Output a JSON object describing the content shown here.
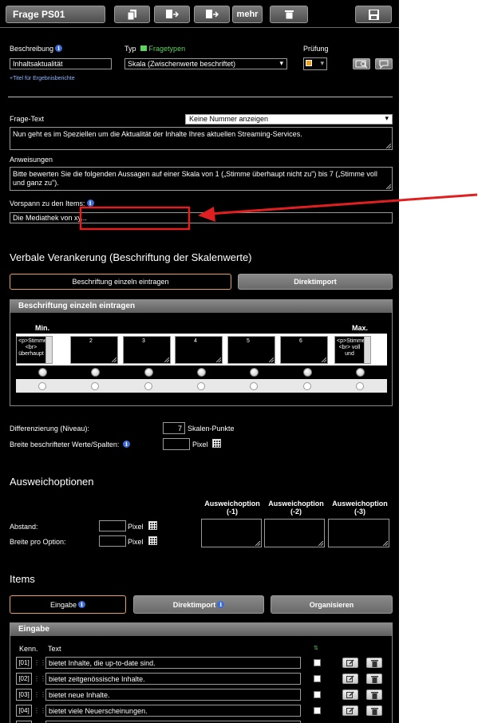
{
  "header": {
    "question_id": "Frage PS01",
    "more_label": "mehr"
  },
  "basics": {
    "description_label": "Beschreibung",
    "description_value": "Inhaltsaktualität",
    "report_title_link": "+Titel für Ergebnisberichte",
    "type_label": "Typ",
    "type_link": "Fragetypen",
    "type_value": "Skala (Zwischenwerte beschriftet)",
    "check_label": "Prüfung"
  },
  "question": {
    "text_label": "Frage-Text",
    "numbering_value": "Keine Nummer anzeigen",
    "text_value": "Nun geht es im Speziellen um die Aktualität der Inhalte Ihres aktuellen Streaming-Services.",
    "instructions_label": "Anweisungen",
    "instructions_value": "Bitte bewerten Sie die folgenden Aussagen auf einer Skala von 1 („Stimme überhaupt nicht zu\") bis 7 („Stimme voll und ganz zu\").",
    "prefix_label": "Vorspann zu den Items:",
    "prefix_value": "Die Mediathek von xy..."
  },
  "anchoring": {
    "heading": "Verbale Verankerung (Beschriftung der Skalenwerte)",
    "btn_individual": "Beschriftung einzeln eintragen",
    "btn_import": "Direktimport",
    "box_title": "Beschriftung einzeln eintragen",
    "min_label": "Min.",
    "max_label": "Max.",
    "scale_labels": [
      "<p>Stimme <br> überhaupt",
      "2",
      "3",
      "4",
      "5",
      "6",
      "<p>Stimme <br> voll und"
    ],
    "differentiation_label": "Differenzierung (Niveau):",
    "differentiation_value": "7",
    "differentiation_unit": "Skalen-Punkte",
    "width_label": "Breite beschrifteter Werte/Spalten:",
    "pixel_label": "Pixel"
  },
  "alternatives": {
    "heading": "Ausweichoptionen",
    "col_headers": [
      "Ausweichoption (-1)",
      "Ausweichoption (-2)",
      "Ausweichoption (-3)"
    ],
    "spacing_label": "Abstand:",
    "width_label": "Breite pro Option:",
    "pixel_label": "Pixel"
  },
  "items": {
    "heading": "Items",
    "btn_input": "Eingabe",
    "btn_import": "Direktimport",
    "btn_organize": "Organisieren",
    "box_title": "Eingabe",
    "col_id": "Kenn.",
    "col_text": "Text",
    "rows": [
      {
        "id": "[01]",
        "text": "bietet Inhalte, die up-to-date sind."
      },
      {
        "id": "[02]",
        "text": "bietet zeitgenössische Inhalte."
      },
      {
        "id": "[03]",
        "text": "bietet neue Inhalte."
      },
      {
        "id": "[04]",
        "text": "bietet viele Neuerscheinungen."
      }
    ]
  },
  "colors": {
    "panel_bg": "#000000",
    "accent_orange": "#e8a15a",
    "annotation_red": "#e02020",
    "link_green": "#5fd35f"
  }
}
